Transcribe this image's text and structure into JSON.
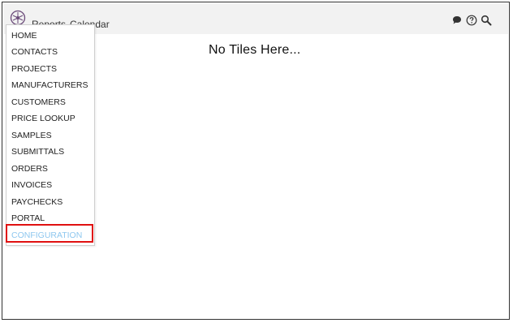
{
  "header": {
    "nav": [
      {
        "label": "Reports"
      },
      {
        "label": "Calendar"
      }
    ],
    "icons": [
      "chat-icon",
      "help-icon",
      "search-icon"
    ]
  },
  "main": {
    "empty_message": "No Tiles Here..."
  },
  "menu": {
    "items": [
      {
        "label": "HOME"
      },
      {
        "label": "CONTACTS"
      },
      {
        "label": "PROJECTS"
      },
      {
        "label": "MANUFACTURERS"
      },
      {
        "label": "CUSTOMERS"
      },
      {
        "label": "PRICE LOOKUP"
      },
      {
        "label": "SAMPLES"
      },
      {
        "label": "SUBMITTALS"
      },
      {
        "label": "ORDERS"
      },
      {
        "label": "INVOICES"
      },
      {
        "label": "PAYCHECKS"
      },
      {
        "label": "PORTAL"
      },
      {
        "label": "CONFIGURATION"
      }
    ],
    "highlighted_item": "CONFIGURATION"
  },
  "colors": {
    "highlight_text": "#8ec7ef",
    "highlight_border": "#e01010",
    "topbar_bg": "#f2f2f2"
  }
}
